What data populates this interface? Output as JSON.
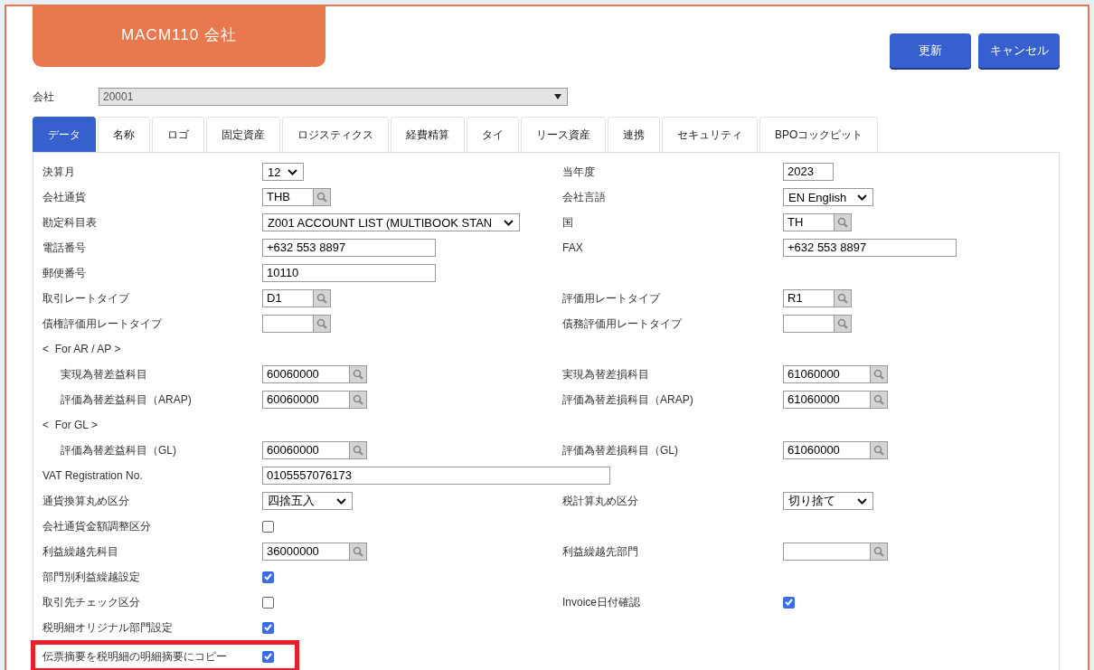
{
  "title": "MACM110 会社",
  "buttons": [
    {
      "label": "更新"
    },
    {
      "label": "キャンセル"
    }
  ],
  "company": {
    "label": "会社",
    "value": "20001"
  },
  "tabs": [
    {
      "label": "データ",
      "selected": true
    },
    {
      "label": "名称",
      "selected": false
    },
    {
      "label": "ロゴ",
      "selected": false
    },
    {
      "label": "固定資産",
      "selected": false
    },
    {
      "label": "ロジスティクス",
      "selected": false
    },
    {
      "label": "経費精算",
      "selected": false
    },
    {
      "label": "タイ",
      "selected": false
    },
    {
      "label": "リース資産",
      "selected": false
    },
    {
      "label": "連携",
      "selected": false
    },
    {
      "label": "セキュリティ",
      "selected": false
    },
    {
      "label": "BPOコックピット",
      "selected": false
    }
  ],
  "rows": [
    {
      "kind": "fields",
      "left": {
        "label": "決算月",
        "field": {
          "kind": "small-select",
          "value": "12"
        }
      },
      "right": {
        "label": "当年度",
        "field": {
          "kind": "short-text",
          "value": "2023"
        }
      }
    },
    {
      "kind": "fields",
      "left": {
        "label": "会社通貨",
        "field": {
          "kind": "lookup",
          "value": "THB"
        }
      },
      "right": {
        "label": "会社言語",
        "field": {
          "kind": "select",
          "value": "EN English"
        }
      }
    },
    {
      "kind": "fields",
      "left": {
        "label": "勘定科目表",
        "field": {
          "kind": "wide-select",
          "value": "Z001 ACCOUNT LIST (MULTIBOOK STAN"
        }
      },
      "right": {
        "label": "国",
        "field": {
          "kind": "lookup",
          "value": "TH"
        }
      }
    },
    {
      "kind": "fields",
      "left": {
        "label": "電話番号",
        "field": {
          "kind": "text",
          "value": "+632 553 8897"
        }
      },
      "right": {
        "label": "FAX",
        "field": {
          "kind": "text",
          "value": "+632 553 8897"
        }
      }
    },
    {
      "kind": "fields",
      "left": {
        "label": "郵便番号",
        "field": {
          "kind": "text",
          "value": "10110"
        }
      }
    },
    {
      "kind": "fields",
      "left": {
        "label": "取引レートタイプ",
        "field": {
          "kind": "lookup",
          "value": "D1"
        }
      },
      "right": {
        "label": "評価用レートタイプ",
        "field": {
          "kind": "lookup",
          "value": "R1"
        }
      }
    },
    {
      "kind": "fields",
      "left": {
        "label": "債権評価用レートタイプ",
        "field": {
          "kind": "lookup"
        }
      },
      "right": {
        "label": "債務評価用レートタイプ",
        "field": {
          "kind": "lookup"
        }
      }
    },
    {
      "kind": "section",
      "label": "<  For AR / AP >"
    },
    {
      "kind": "fields",
      "indented": true,
      "left": {
        "label": "実現為替差益科目",
        "field": {
          "kind": "wide-lookup",
          "value": "60060000"
        }
      },
      "right": {
        "label": "実現為替差損科目",
        "field": {
          "kind": "wide-lookup",
          "value": "61060000"
        }
      }
    },
    {
      "kind": "fields",
      "indented": true,
      "left": {
        "label": "評価為替差益科目（ARAP)",
        "field": {
          "kind": "wide-lookup",
          "value": "60060000"
        }
      },
      "right": {
        "label": "評価為替差損科目（ARAP)",
        "field": {
          "kind": "wide-lookup",
          "value": "61060000"
        }
      }
    },
    {
      "kind": "section",
      "label": "<  For GL >"
    },
    {
      "kind": "fields",
      "indented": true,
      "left": {
        "label": "評価為替差益科目（GL)",
        "field": {
          "kind": "wide-lookup",
          "value": "60060000"
        }
      },
      "right": {
        "label": "評価為替差損科目（GL)",
        "field": {
          "kind": "wide-lookup",
          "value": "61060000"
        }
      }
    },
    {
      "kind": "fields",
      "left": {
        "label": "VAT Registration No.",
        "field": {
          "kind": "long-text",
          "value": "0105557076173"
        }
      }
    },
    {
      "kind": "fields",
      "left": {
        "label": "通貨換算丸め区分",
        "field": {
          "kind": "select",
          "value": "四捨五入"
        }
      },
      "right": {
        "label": "税計算丸め区分",
        "field": {
          "kind": "select",
          "value": "切り捨て"
        }
      }
    },
    {
      "kind": "fields",
      "left": {
        "label": "会社通貨金額調整区分",
        "field": {
          "kind": "checkbox",
          "checked": false
        }
      }
    },
    {
      "kind": "fields",
      "left": {
        "label": "利益繰越先科目",
        "field": {
          "kind": "wide-lookup",
          "value": "36000000"
        }
      },
      "right": {
        "label": "利益繰越先部門",
        "field": {
          "kind": "wide-lookup"
        }
      }
    },
    {
      "kind": "fields",
      "left": {
        "label": "部門別利益繰越設定",
        "field": {
          "kind": "checkbox",
          "checked": true
        }
      }
    },
    {
      "kind": "fields",
      "left": {
        "label": "取引先チェック区分",
        "field": {
          "kind": "checkbox",
          "checked": false
        }
      },
      "right": {
        "label": "Invoice日付確認",
        "field": {
          "kind": "checkbox",
          "checked": true
        }
      }
    },
    {
      "kind": "fields",
      "left": {
        "label": "税明細オリジナル部門設定",
        "field": {
          "kind": "checkbox",
          "checked": true
        }
      }
    },
    {
      "kind": "fields",
      "highlighted": true,
      "left": {
        "label": "伝票摘要を税明細の明細摘要にコピー",
        "field": {
          "kind": "checkbox",
          "checked": true
        }
      }
    }
  ]
}
